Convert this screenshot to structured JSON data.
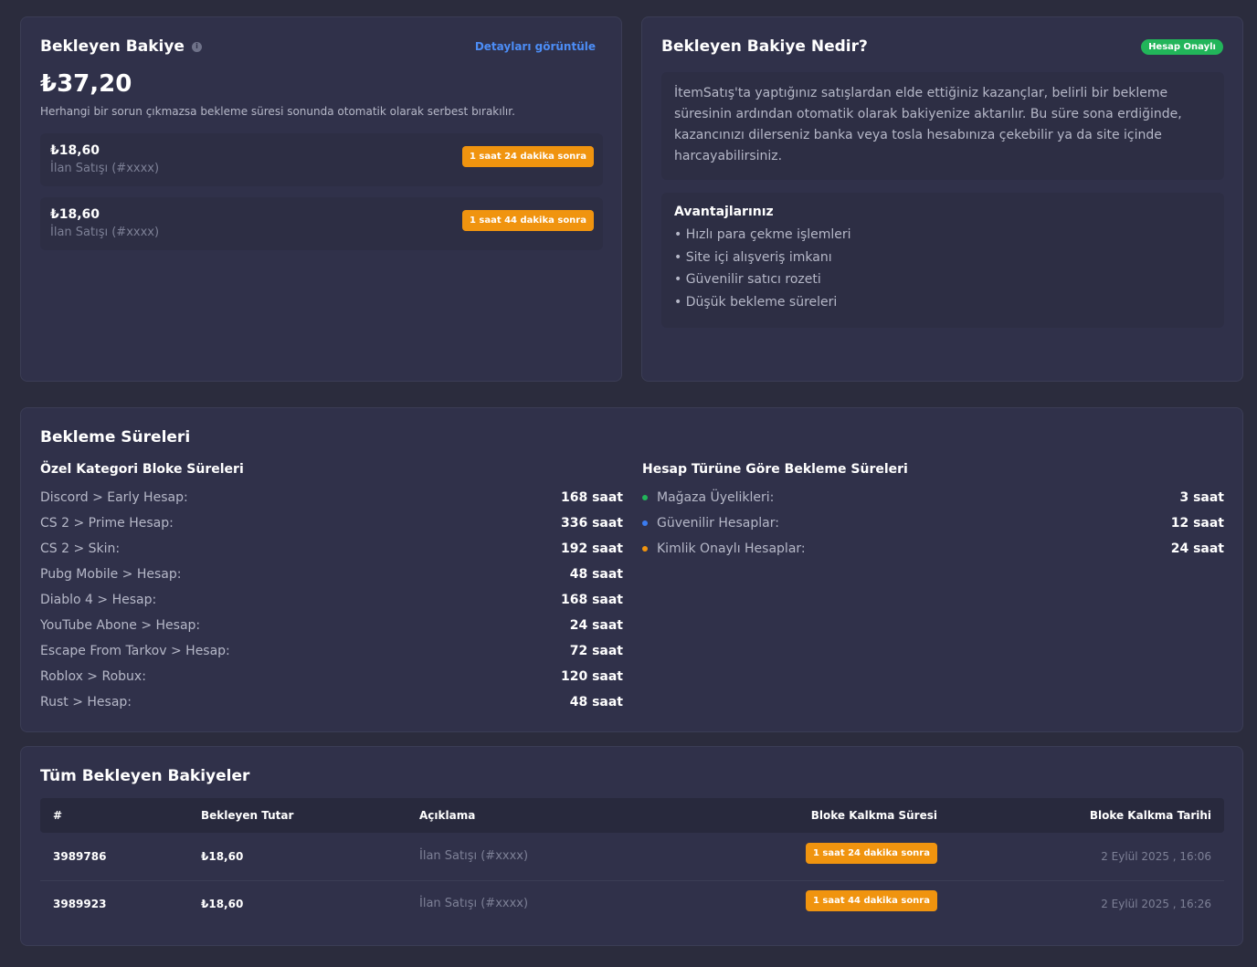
{
  "pending": {
    "title": "Bekleyen Bakiye",
    "info_icon": "i",
    "details_link": "Detayları görüntüle",
    "amount": "₺37,20",
    "note": "Herhangi bir sorun çıkmazsa bekleme süresi sonunda otomatik olarak serbest bırakılır.",
    "entries": [
      {
        "amount": "₺18,60",
        "desc": "İlan Satışı (#xxxx)",
        "badge": "1 saat 24 dakika sonra"
      },
      {
        "amount": "₺18,60",
        "desc": "İlan Satışı (#xxxx)",
        "badge": "1 saat 44 dakika sonra"
      }
    ]
  },
  "whatis": {
    "title": "Bekleyen Bakiye Nedir?",
    "badge": "Hesap Onaylı",
    "text": "İtemSatış'ta yaptığınız satışlardan elde ettiğiniz kazançlar, belirli bir bekleme süresinin ardından otomatik olarak bakiyenize aktarılır. Bu süre sona erdiğinde, kazancınızı dilerseniz banka veya tosla hesabınıza çekebilir ya da site içinde harcayabilirsiniz.",
    "advantages_title": "Avantajlarınız",
    "advantages": [
      "• Hızlı para çekme işlemleri",
      "• Site içi alışveriş imkanı",
      "• Güvenilir satıcı rozeti",
      "• Düşük bekleme süreleri"
    ]
  },
  "waiting": {
    "title": "Bekleme Süreleri",
    "category_heading": "Özel Kategori Bloke Süreleri",
    "categories": [
      {
        "label": "Discord > Early Hesap:",
        "value": "168 saat"
      },
      {
        "label": "CS 2 > Prime Hesap:",
        "value": "336 saat"
      },
      {
        "label": "CS 2 > Skin:",
        "value": "192 saat"
      },
      {
        "label": "Pubg Mobile > Hesap:",
        "value": "48 saat"
      },
      {
        "label": "Diablo 4 > Hesap:",
        "value": "168 saat"
      },
      {
        "label": "YouTube Abone > Hesap:",
        "value": "24 saat"
      },
      {
        "label": "Escape From Tarkov > Hesap:",
        "value": "72 saat"
      },
      {
        "label": "Roblox > Robux:",
        "value": "120 saat"
      },
      {
        "label": "Rust > Hesap:",
        "value": "48 saat"
      }
    ],
    "account_heading": "Hesap Türüne Göre Bekleme Süreleri",
    "account_types": [
      {
        "label": "Mağaza Üyelikleri:",
        "value": "3 saat",
        "color": "#22b55a"
      },
      {
        "label": "Güvenilir Hesaplar:",
        "value": "12 saat",
        "color": "#3b7cf0"
      },
      {
        "label": "Kimlik Onaylı Hesaplar:",
        "value": "24 saat",
        "color": "#f0940f"
      }
    ]
  },
  "allpending": {
    "title": "Tüm Bekleyen Bakiyeler",
    "columns": [
      "#",
      "Bekleyen Tutar",
      "Açıklama",
      "Bloke Kalkma Süresi",
      "Bloke Kalkma Tarihi"
    ],
    "rows": [
      {
        "id": "3989786",
        "amount": "₺18,60",
        "desc": "İlan Satışı (#xxxx)",
        "remaining": "1 saat 24 dakika sonra",
        "date": "2 Eylül 2025 , 16:06"
      },
      {
        "id": "3989923",
        "amount": "₺18,60",
        "desc": "İlan Satışı (#xxxx)",
        "remaining": "1 saat 44 dakika sonra",
        "date": "2 Eylül 2025 , 16:26"
      }
    ]
  },
  "colors": {
    "background": "#2b2c3d",
    "card": "#30314a",
    "accent_link": "#4c8df6",
    "badge_orange": "#f0940f",
    "badge_green": "#22b55a"
  }
}
